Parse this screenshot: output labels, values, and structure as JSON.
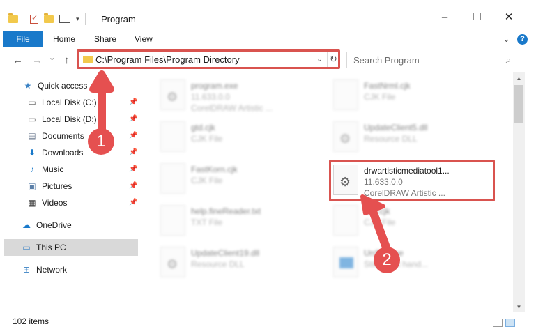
{
  "window": {
    "title": "Program",
    "minimize": "–",
    "maximize": "☐",
    "close": "✕"
  },
  "ribbon": {
    "tabs": [
      "File",
      "Home",
      "Share",
      "View"
    ],
    "collapse": "⌄",
    "help": "?"
  },
  "nav": {
    "back": "←",
    "forward": "→",
    "recent": "⌄",
    "up": "↑",
    "address": "C:\\Program Files\\Program Directory",
    "dropdown": "⌄",
    "refresh": "↻",
    "search_placeholder": "Search Program",
    "search_icon": "⌕"
  },
  "sidebar": {
    "items": [
      {
        "label": "Quick access",
        "icon": "star-icon",
        "glyph": "★",
        "color": "#3b82c4"
      },
      {
        "label": "Local Disk (C:)",
        "icon": "drive-icon",
        "glyph": "▭",
        "color": "#555555",
        "pinned": true
      },
      {
        "label": "Local Disk (D:)",
        "icon": "drive-icon",
        "glyph": "▭",
        "color": "#555555",
        "pinned": true
      },
      {
        "label": "Documents",
        "icon": "documents-icon",
        "glyph": "▤",
        "color": "#6b7a8f",
        "pinned": true
      },
      {
        "label": "Downloads",
        "icon": "download-icon",
        "glyph": "⬇",
        "color": "#1979ca",
        "pinned": true
      },
      {
        "label": "Music",
        "icon": "music-icon",
        "glyph": "♪",
        "color": "#1979ca",
        "pinned": true
      },
      {
        "label": "Pictures",
        "icon": "pictures-icon",
        "glyph": "▣",
        "color": "#5a7fa8",
        "pinned": true
      },
      {
        "label": "Videos",
        "icon": "videos-icon",
        "glyph": "▦",
        "color": "#444444",
        "pinned": true
      },
      {
        "label": "OneDrive",
        "icon": "cloud-icon",
        "glyph": "☁",
        "color": "#1979ca"
      },
      {
        "label": "This PC",
        "icon": "computer-icon",
        "glyph": "▭",
        "color": "#3b82c4",
        "selected": true
      },
      {
        "label": "Network",
        "icon": "network-icon",
        "glyph": "⊞",
        "color": "#3b82c4"
      }
    ],
    "pin_glyph": "📌"
  },
  "files": [
    {
      "name": "program.exe",
      "line2": "11.633.0.0",
      "line3": "CorelDRAW Artistic ...",
      "icon": "exe-icon",
      "blurred": true
    },
    {
      "name": "FastNrml.cjk",
      "line2": "CJK File",
      "line3": "",
      "icon": "file-icon",
      "blurred": true
    },
    {
      "name": "gtd.cjk",
      "line2": "CJK File",
      "line3": "",
      "icon": "file-icon",
      "blurred": true
    },
    {
      "name": "UpdateClient5.dll",
      "line2": "Resource DLL",
      "line3": "",
      "icon": "dll-icon",
      "blurred": true
    },
    {
      "name": "FastKorn.cjk",
      "line2": "CJK File",
      "line3": "",
      "icon": "file-icon",
      "blurred": true
    },
    {
      "name": "drwartisticmediatool1...",
      "line2": "11.633.0.0",
      "line3": "CorelDRAW Artistic ...",
      "icon": "gear-file-icon",
      "blurred": false
    },
    {
      "name": "help.fineReader.txt",
      "line2": "TXT File",
      "line3": "",
      "icon": "file-icon",
      "blurred": true
    },
    {
      "name": "fast.cjk",
      "line2": "CJK File",
      "line3": "",
      "icon": "file-icon",
      "blurred": true
    },
    {
      "name": "UpdateClient19.dll",
      "line2": "Resource DLL",
      "line3": "",
      "icon": "dll-icon",
      "blurred": true
    },
    {
      "name": "UnSTI.exe",
      "line2": "Still event hand...",
      "line3": "",
      "icon": "exe-blue-icon",
      "blurred": true
    }
  ],
  "status": {
    "count": "102 items"
  },
  "annotations": {
    "badge1": "1",
    "badge2": "2",
    "color": "#e55050"
  },
  "scroll": {
    "up": "▲",
    "down": "▼"
  }
}
